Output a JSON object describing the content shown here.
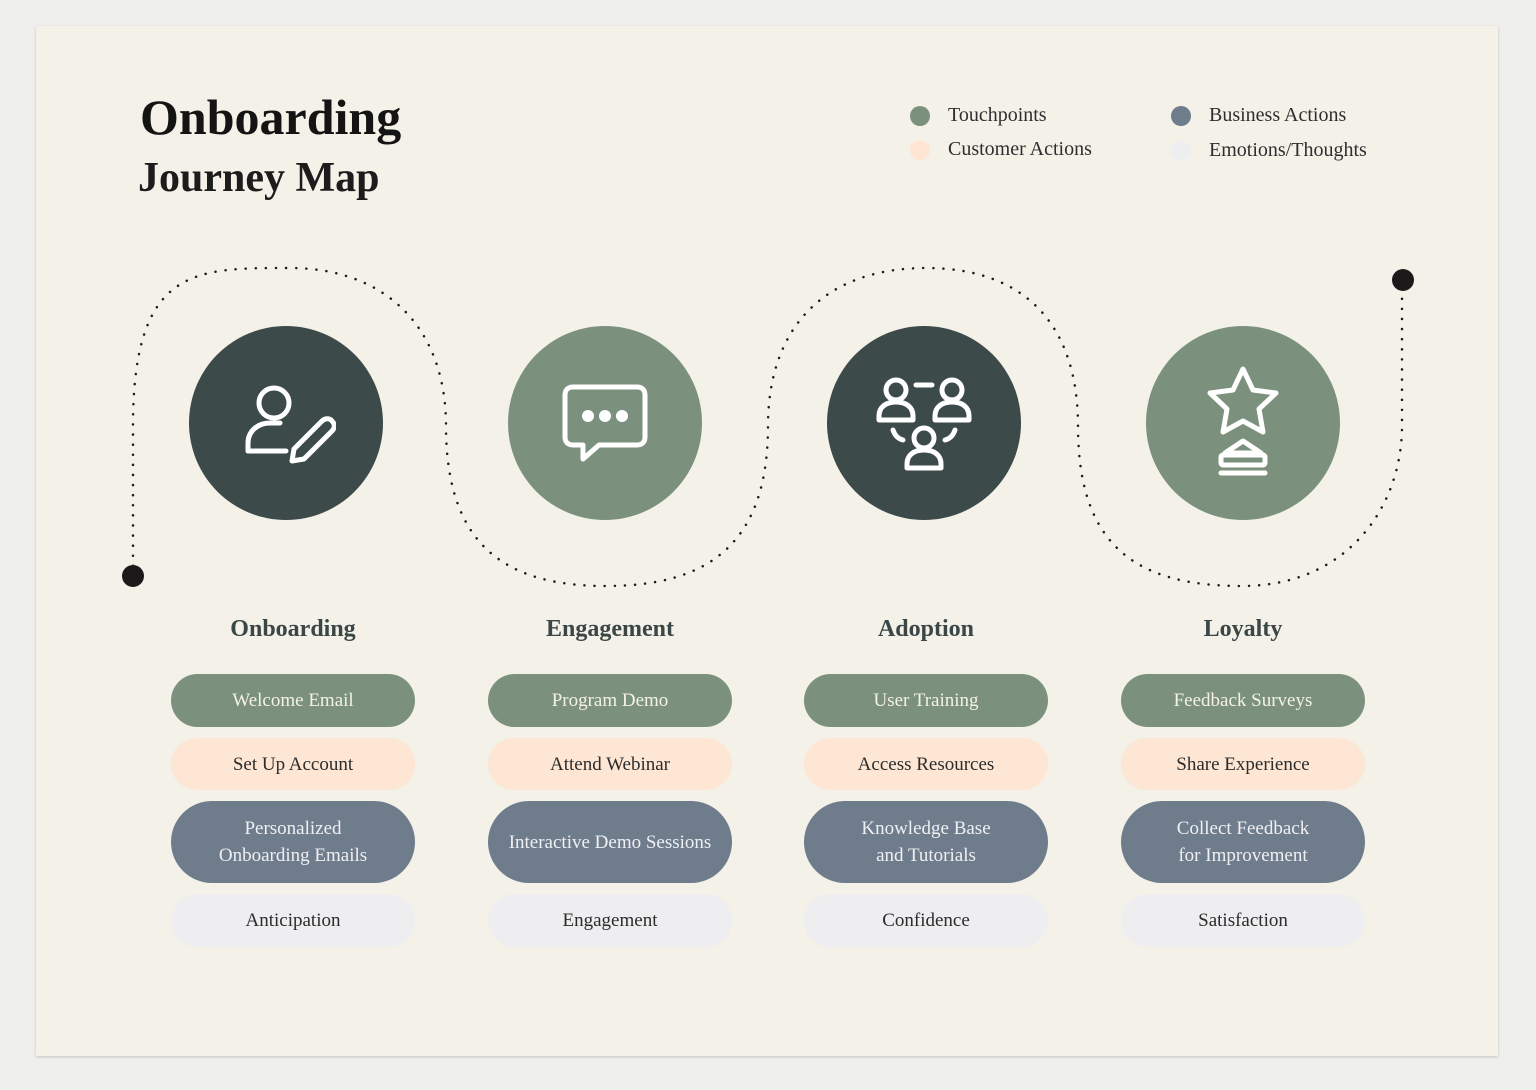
{
  "header": {
    "title": "Onboarding",
    "subtitle": "Journey Map"
  },
  "colors": {
    "touchpoints": "#7b917e",
    "customer_actions": "#fde6d3",
    "business_actions": "#6f7c8c",
    "emotions_thoughts": "#eeedef",
    "dark_circle": "#3d4a4a",
    "sage_circle": "#7b917e"
  },
  "legend": [
    {
      "label": "Touchpoints",
      "color": "#7b917e"
    },
    {
      "label": "Customer Actions",
      "color": "#fde6d3"
    },
    {
      "label": "Business Actions",
      "color": "#6f7c8c"
    },
    {
      "label": "Emotions/Thoughts",
      "color": "#eeedef"
    }
  ],
  "stages": [
    {
      "title": "Onboarding",
      "icon": "user-edit-icon",
      "circle_color": "#3d4a4a",
      "touchpoint": "Welcome Email",
      "customer_action": "Set Up Account",
      "business_action": "Personalized\nOnboarding Emails",
      "emotion": "Anticipation"
    },
    {
      "title": "Engagement",
      "icon": "chat-bubble-icon",
      "circle_color": "#7b917e",
      "touchpoint": "Program Demo",
      "customer_action": "Attend Webinar",
      "business_action": "Interactive Demo Sessions",
      "emotion": "Engagement"
    },
    {
      "title": "Adoption",
      "icon": "team-icon",
      "circle_color": "#3d4a4a",
      "touchpoint": "User Training",
      "customer_action": "Access Resources",
      "business_action": "Knowledge Base\nand Tutorials",
      "emotion": "Confidence"
    },
    {
      "title": "Loyalty",
      "icon": "star-trophy-icon",
      "circle_color": "#7b917e",
      "touchpoint": "Feedback Surveys",
      "customer_action": "Share Experience",
      "business_action": "Collect Feedback\nfor Improvement",
      "emotion": "Satisfaction"
    }
  ]
}
